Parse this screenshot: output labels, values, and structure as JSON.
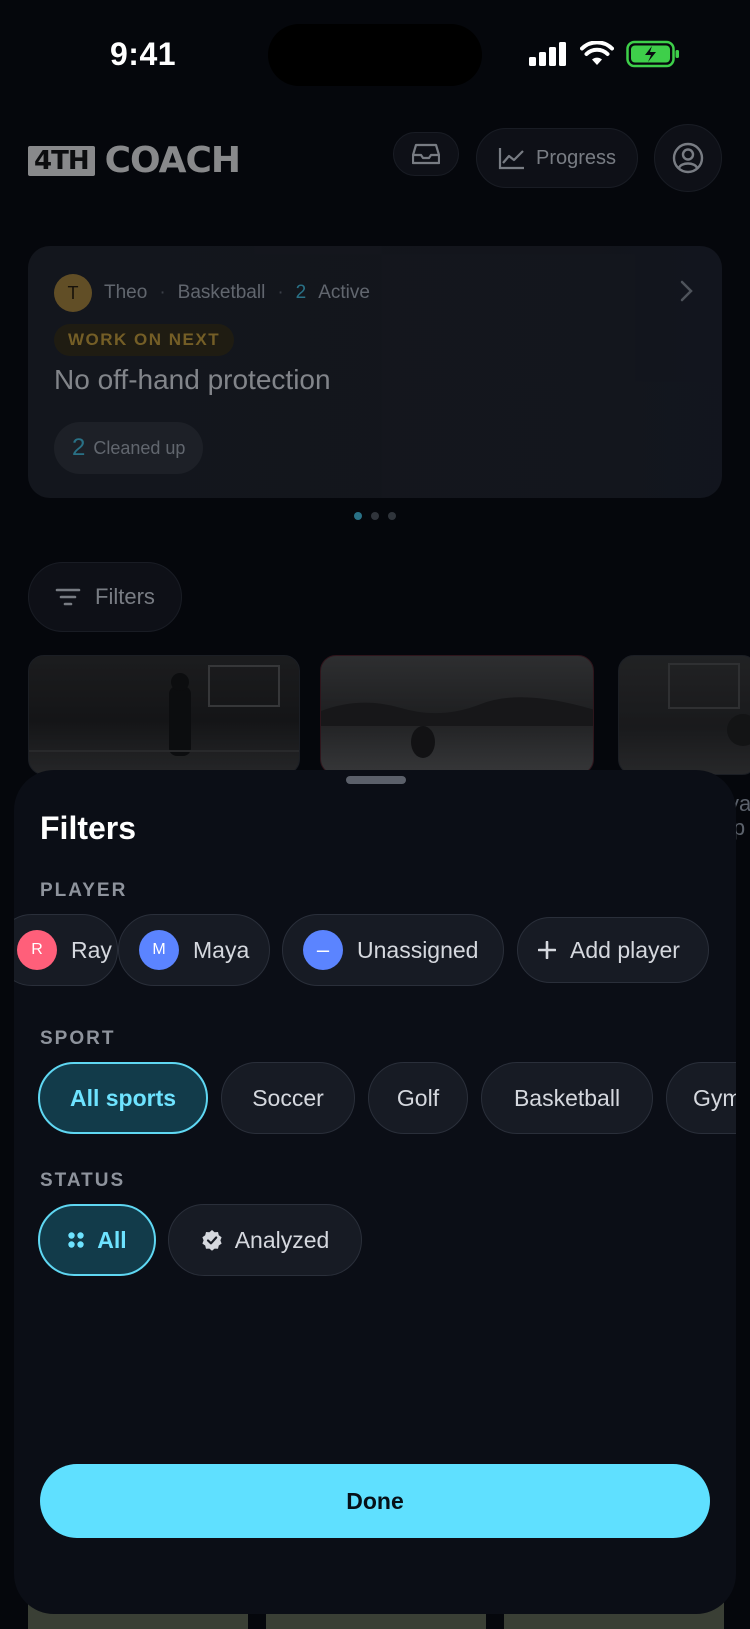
{
  "status_bar": {
    "time": "9:41"
  },
  "header": {
    "logo_box": "4TH",
    "logo_word": "COACH",
    "progress_label": "Progress"
  },
  "focus_card": {
    "avatar_initial": "T",
    "player": "Theo",
    "sport": "Basketball",
    "active_count": "2",
    "active_label": "Active",
    "tag": "WORK ON NEXT",
    "title": "No off-hand protection",
    "cleaned_count": "2",
    "cleaned_label": "Cleaned up"
  },
  "filters_button": {
    "label": "Filters"
  },
  "peek_text": {
    "line1": "ya",
    "line2": "ip"
  },
  "sheet": {
    "title": "Filters",
    "player_section": {
      "label": "PLAYER",
      "chips": [
        {
          "label": "Ray",
          "avatar": "R",
          "avatar_color": "#ff5f7a"
        },
        {
          "label": "Maya",
          "avatar": "M",
          "avatar_color": "#5b84ff"
        },
        {
          "label": "Unassigned",
          "avatar": "–",
          "avatar_color": "#5b84ff"
        },
        {
          "label": "Add player"
        }
      ]
    },
    "sport_section": {
      "label": "SPORT",
      "chips": [
        "All sports",
        "Soccer",
        "Golf",
        "Basketball",
        "Gymnastics"
      ],
      "selected": "All sports"
    },
    "status_section": {
      "label": "STATUS",
      "chips": [
        "All",
        "Analyzed"
      ],
      "selected": "All"
    },
    "done_label": "Done"
  },
  "colors": {
    "accent": "#5fe0ff",
    "selected_bg": "#123b4a",
    "sheet_bg": "#0b0e16",
    "teal_number": "#3fb3d1",
    "tag_gold": "#b99436"
  }
}
